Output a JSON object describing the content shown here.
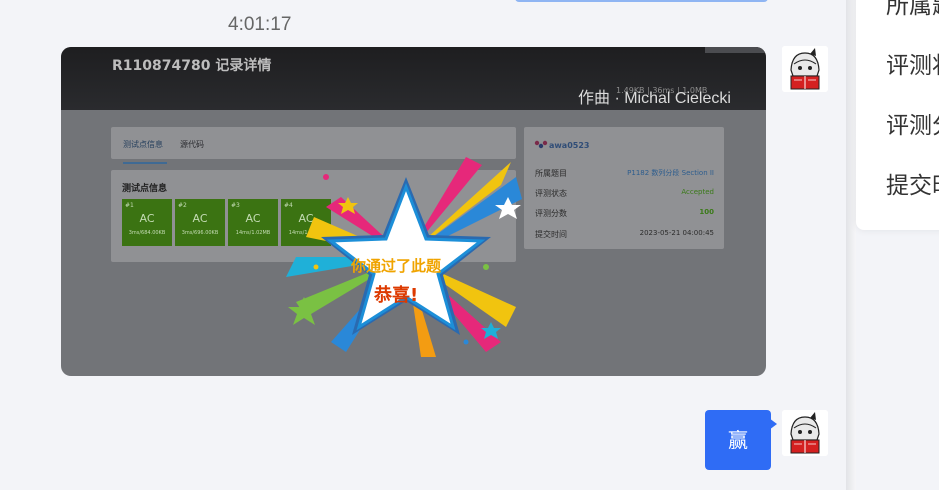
{
  "chat": {
    "timestamp": "4:01:17",
    "reply_text": "赢"
  },
  "screenshot": {
    "record_title": "R110874780 记录详情",
    "credit": "作曲 · Michal Cielecki",
    "faded_stats": "1.49KB  |  36ms  |  1.0MB",
    "tabs": [
      "测试点信息",
      "源代码"
    ],
    "section_title": "测试点信息",
    "test_cases": [
      {
        "num": "#1",
        "status": "AC",
        "metrics": "3ms/684.00KB"
      },
      {
        "num": "#2",
        "status": "AC",
        "metrics": "3ms/696.00KB"
      },
      {
        "num": "#3",
        "status": "AC",
        "metrics": "14ms/1.02MB"
      },
      {
        "num": "#4",
        "status": "AC",
        "metrics": "14ms/1.02MB"
      }
    ],
    "user": "awa0523",
    "info": [
      {
        "key": "所属题目",
        "value": "P1182 数列分段 Section II",
        "color": "#2d5d8e"
      },
      {
        "key": "评测状态",
        "value": "Accepted",
        "color": "#3a7a18"
      },
      {
        "key": "评测分数",
        "value": "100",
        "color": "#3a7a18"
      },
      {
        "key": "提交时间",
        "value": "2023-05-21 04:00:45",
        "color": "#2c2c2c"
      }
    ],
    "overlay_line1": "你通过了此题",
    "overlay_line2": "恭喜!"
  },
  "right_panel": {
    "items": [
      "所属题",
      "评测状",
      "评测分",
      "提交时"
    ]
  },
  "colors": {
    "accent_blue": "#2f6cf5",
    "accepted_green": "#3b7312"
  }
}
